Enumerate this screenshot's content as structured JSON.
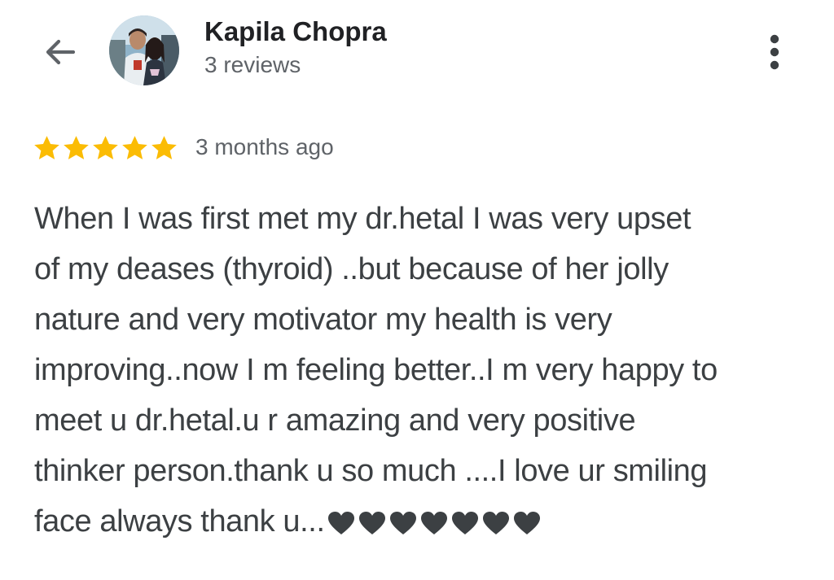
{
  "header": {
    "back_icon": "arrow-left-icon",
    "reviewer_name": "Kapila Chopra",
    "review_count": "3 reviews",
    "more_icon": "more-vertical-icon",
    "avatar": "reviewer-avatar"
  },
  "review": {
    "rating": 5,
    "max_rating": 5,
    "star_color": "#fbbc04",
    "time_ago": "3 months ago",
    "text_lines": [
      "When I was first met my dr.hetal I was very upset",
      "of my deases (thyroid) ..but because of her jolly",
      "nature and very motivator my health is very",
      "improving..now I m feeling better..I m very happy to",
      "meet u dr.hetal.u r amazing and very positive",
      "thinker person.thank u so much ....I love ur smiling",
      "face always thank u..."
    ],
    "heart_count": 7,
    "heart_icon": "black-heart-icon"
  }
}
